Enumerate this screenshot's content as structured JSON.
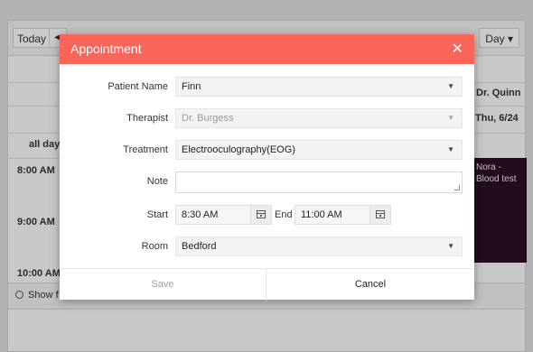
{
  "background": {
    "toolbar": {
      "today_label": "Today",
      "nav_prev": "◀",
      "view_label": "Day ▾"
    },
    "resource_label": "Dr. Quinn",
    "date_label": "Thu, 6/24",
    "all_day_label": "all day",
    "times": [
      "8:00 AM",
      "9:00 AM",
      "10:00 AM"
    ],
    "event": {
      "label": "Nora - Blood test",
      "color": "#2a0f24"
    },
    "show_full_label": "Show f"
  },
  "dialog": {
    "title": "Appointment",
    "close_glyph": "✕",
    "header_color": "#fb6458",
    "fields": {
      "patient": {
        "label": "Patient Name",
        "value": "Finn"
      },
      "therapist": {
        "label": "Therapist",
        "value": "Dr. Burgess"
      },
      "treatment": {
        "label": "Treatment",
        "value": "Electrooculography(EOG)"
      },
      "note": {
        "label": "Note",
        "value": ""
      },
      "start": {
        "label": "Start",
        "value": "8:30 AM"
      },
      "end": {
        "label": "End",
        "value": "11:00 AM"
      },
      "room": {
        "label": "Room",
        "value": "Bedford"
      }
    },
    "caret_glyph": "▼",
    "footer": {
      "save_label": "Save",
      "cancel_label": "Cancel"
    }
  }
}
